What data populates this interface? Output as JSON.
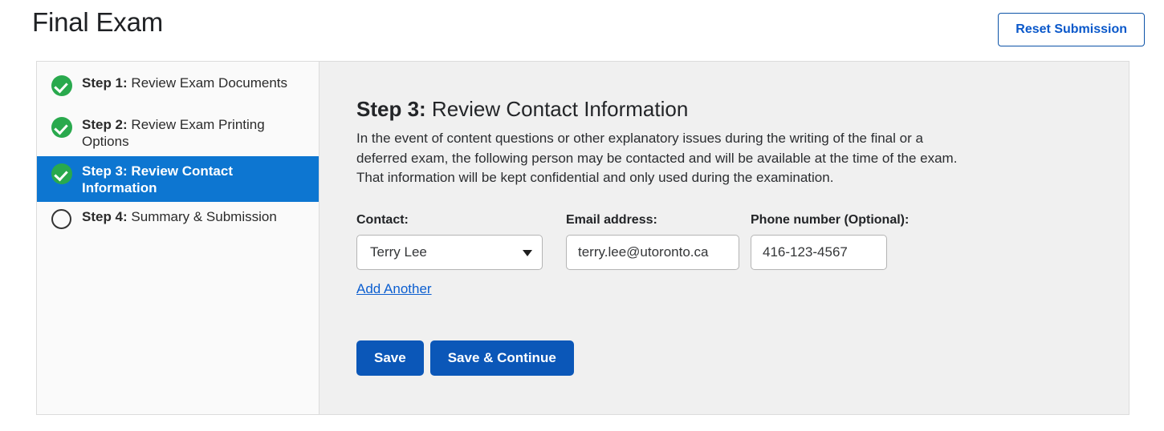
{
  "header": {
    "title": "Final Exam",
    "reset_button": "Reset Submission"
  },
  "sidebar": {
    "steps": [
      {
        "num": "Step 1:",
        "label": " Review Exam Documents",
        "state": "done",
        "icon": "check-circle-icon"
      },
      {
        "num": "Step 2:",
        "label": " Review Exam Printing Options",
        "state": "done",
        "icon": "check-circle-icon"
      },
      {
        "num": "Step 3:",
        "label": " Review Contact Information",
        "state": "active",
        "icon": "check-circle-icon"
      },
      {
        "num": "Step 4:",
        "label": " Summary & Submission",
        "state": "todo",
        "icon": "empty-circle-icon"
      }
    ]
  },
  "main": {
    "title_num": "Step 3:",
    "title_label": " Review Contact Information",
    "description": "In the event of content questions or other explanatory issues during the writing of the final or a deferred exam, the following person may be contacted and will be available at the time of the exam. That information will be kept confidential and only used during the examination.",
    "form": {
      "contact_label": "Contact:",
      "contact_value": "Terry Lee",
      "contact_options": [
        "Terry Lee"
      ],
      "email_label": "Email address:",
      "email_value": "terry.lee@utoronto.ca",
      "email_placeholder": "",
      "phone_label": "Phone number (Optional):",
      "phone_value": "416-123-4567",
      "phone_placeholder": "",
      "add_another": "Add Another"
    },
    "buttons": {
      "save": "Save",
      "save_continue": "Save & Continue"
    }
  },
  "colors": {
    "accent_blue": "#0d76d1",
    "button_blue": "#0b57b8",
    "link_blue": "#0d5fd0",
    "success_green": "#29a94d",
    "panel_bg": "#f0f0f0",
    "sidebar_bg": "#fafafa"
  }
}
